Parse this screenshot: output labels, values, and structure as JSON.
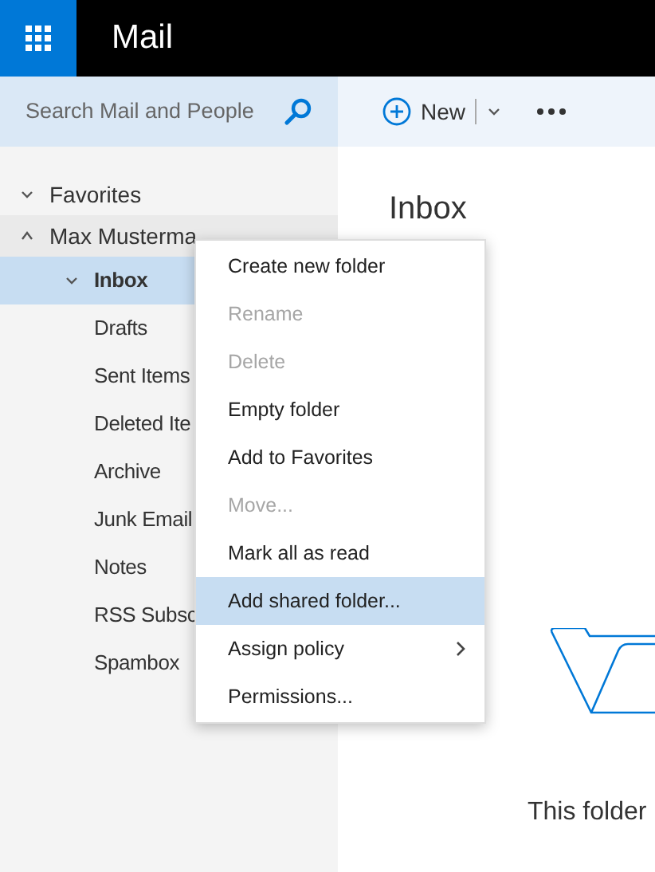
{
  "app": {
    "title": "Mail"
  },
  "search": {
    "placeholder": "Search Mail and People"
  },
  "toolbar": {
    "new_label": "New"
  },
  "sidebar": {
    "items": [
      {
        "label": "Favorites",
        "expanded": false,
        "selected": false
      },
      {
        "label": "Max Musterma",
        "expanded": true,
        "selected": false,
        "children": [
          {
            "label": "Inbox",
            "expanded": false,
            "selected": true
          },
          {
            "label": "Drafts",
            "selected": false
          },
          {
            "label": "Sent Items",
            "selected": false
          },
          {
            "label": "Deleted Ite",
            "selected": false
          },
          {
            "label": "Archive",
            "selected": false
          },
          {
            "label": "Junk Email",
            "selected": false
          },
          {
            "label": "Notes",
            "selected": false
          },
          {
            "label": "RSS Subsc",
            "selected": false
          },
          {
            "label": "Spambox",
            "selected": false
          }
        ]
      }
    ]
  },
  "context_menu": [
    {
      "label": "Create new folder",
      "disabled": false,
      "selected": false,
      "submenu": false
    },
    {
      "label": "Rename",
      "disabled": true,
      "selected": false,
      "submenu": false
    },
    {
      "label": "Delete",
      "disabled": true,
      "selected": false,
      "submenu": false
    },
    {
      "label": "Empty folder",
      "disabled": false,
      "selected": false,
      "submenu": false
    },
    {
      "label": "Add to Favorites",
      "disabled": false,
      "selected": false,
      "submenu": false
    },
    {
      "label": "Move...",
      "disabled": true,
      "selected": false,
      "submenu": false
    },
    {
      "label": "Mark all as read",
      "disabled": false,
      "selected": false,
      "submenu": false
    },
    {
      "label": "Add shared folder...",
      "disabled": false,
      "selected": true,
      "submenu": false
    },
    {
      "label": "Assign policy",
      "disabled": false,
      "selected": false,
      "submenu": true
    },
    {
      "label": "Permissions...",
      "disabled": false,
      "selected": false,
      "submenu": false
    }
  ],
  "content": {
    "title": "Inbox",
    "empty_message": "This folder"
  }
}
